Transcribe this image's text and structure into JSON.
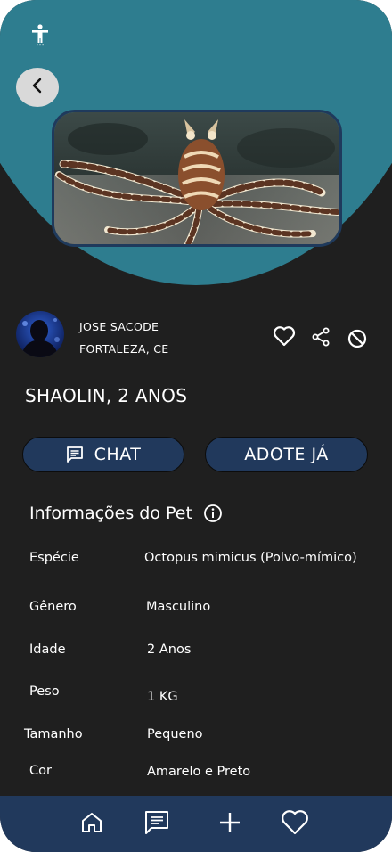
{
  "owner": {
    "name": "JOSE SACODE",
    "location": "FORTALEZA, CE"
  },
  "pet": {
    "title": "SHAOLIN, 2 ANOS"
  },
  "actions": {
    "chat_label": "CHAT",
    "adopt_label": "ADOTE JÁ"
  },
  "info": {
    "section_title": "Informações do Pet",
    "rows": [
      {
        "label": "Espécie",
        "value": "Octopus mimicus (Polvo-mímico)"
      },
      {
        "label": "Gênero",
        "value": "Masculino"
      },
      {
        "label": "Idade",
        "value": "2 Anos"
      },
      {
        "label": "Peso",
        "value": "1 KG"
      },
      {
        "label": "Tamanho",
        "value": "Pequeno"
      },
      {
        "label": "Cor",
        "value": "Amarelo e Preto"
      }
    ]
  },
  "icons": {
    "accessibility": "accessibility-icon",
    "back": "chevron-left-icon",
    "favorite": "heart-icon",
    "share": "share-icon",
    "block": "block-icon",
    "chat": "message-icon",
    "info": "info-icon",
    "nav_home": "home-icon",
    "nav_messages": "message-icon",
    "nav_add": "plus-icon",
    "nav_favorites": "heart-icon"
  },
  "colors": {
    "header": "#2e7d8f",
    "background": "#1f1f1f",
    "button": "#21395c",
    "navbar": "#21395c"
  }
}
